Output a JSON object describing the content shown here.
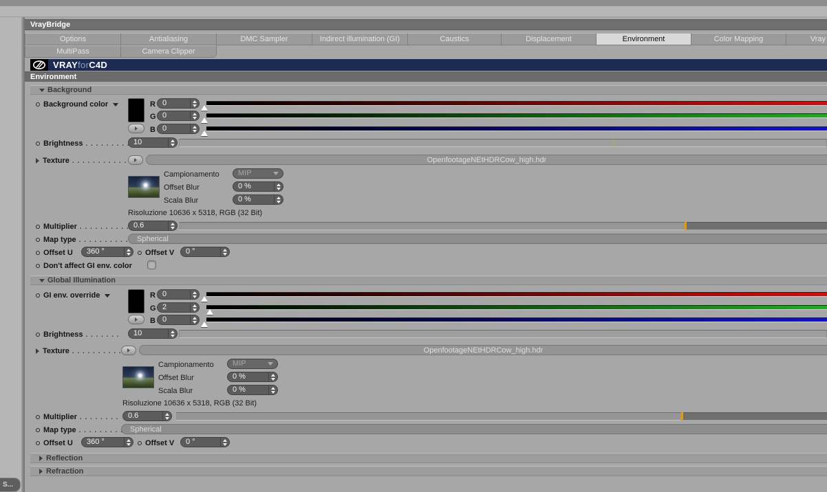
{
  "window": {
    "title": "VrayBridge",
    "status_label": "S..."
  },
  "tabs": {
    "row1": [
      "Options",
      "Antialiasing",
      "DMC Sampler",
      "Indirect illumination (GI)",
      "Caustics",
      "Displacement",
      "Environment",
      "Color Mapping",
      "Vray"
    ],
    "row2": [
      "MultiPass",
      "Camera Clipper"
    ],
    "selected": "Environment"
  },
  "logo": {
    "part1": "VRAY",
    "part2": "for",
    "part3": "C4D"
  },
  "page_header": {
    "title": "Environment"
  },
  "colors": {
    "accent_orange": "#e09c00",
    "logo_navy": "#1c2b52",
    "red_end": "#cf0f0f",
    "green_end": "#1fad1f",
    "blue_end": "#1313c8"
  },
  "bg": {
    "section_title": "Background",
    "color_label": "Background color",
    "r_label": "R",
    "g_label": "G",
    "b_label": "B",
    "r": "0",
    "g": "0",
    "b": "0",
    "brightness_label": "Brightness",
    "brightness_dots": ". . . . . . . . .",
    "brightness": "10",
    "texture_label": "Texture",
    "texture_dots": ". . . . . . . . . . . .",
    "texture_file": "OpenfootageNEtHDRCow_high.hdr",
    "sampling_label": "Campionamento",
    "sampling": "MIP",
    "offset_blur_label": "Offset Blur",
    "offset_blur": "0 %",
    "scala_blur_label": "Scala Blur",
    "scala_blur": "0 %",
    "resolution": "Risoluzione 10636 x 5318, RGB (32 Bit)",
    "multiplier_label": "Multiplier",
    "multiplier_dots": ". . . . . . . . . .",
    "multiplier": "0.6",
    "map_type_label": "Map type",
    "map_type_dots": ". . . . . . . . . .",
    "map_type": "Spherical",
    "offset_u_label": "Offset U",
    "offset_u": "360 °",
    "offset_v_label": "Offset V",
    "offset_v": "0 °",
    "dont_affect_label": "Don't affect GI env. color",
    "dont_affect_checked": false
  },
  "gi": {
    "section_title": "Global Illumination",
    "color_label": "GI env. override",
    "r_label": "R",
    "g_label": "G",
    "b_label": "B",
    "r": "0",
    "g": "2",
    "b": "0",
    "brightness_label": "Brightness",
    "brightness_dots": ". . . . . . .",
    "brightness": "10",
    "texture_label": "Texture",
    "texture_dots": ". . . . . . . . . .",
    "texture_file": "OpenfootageNEtHDRCow_high.hdr",
    "sampling_label": "Campionamento",
    "sampling": "MIP",
    "offset_blur_label": "Offset Blur",
    "offset_blur": "0 %",
    "scala_blur_label": "Scala Blur",
    "scala_blur": "0 %",
    "resolution": "Risoluzione 10636 x 5318, RGB (32 Bit)",
    "multiplier_label": "Multiplier",
    "multiplier_dots": ". . . . . . . .",
    "multiplier": "0.6",
    "map_type_label": "Map type",
    "map_type_dots": ". . . . . . . . .",
    "map_type": "Spherical",
    "offset_u_label": "Offset U",
    "offset_u": "360 °",
    "offset_v_label": "Offset V",
    "offset_v": "0 °"
  },
  "collapsed_sections": {
    "reflection": "Reflection",
    "refraction": "Refraction"
  }
}
